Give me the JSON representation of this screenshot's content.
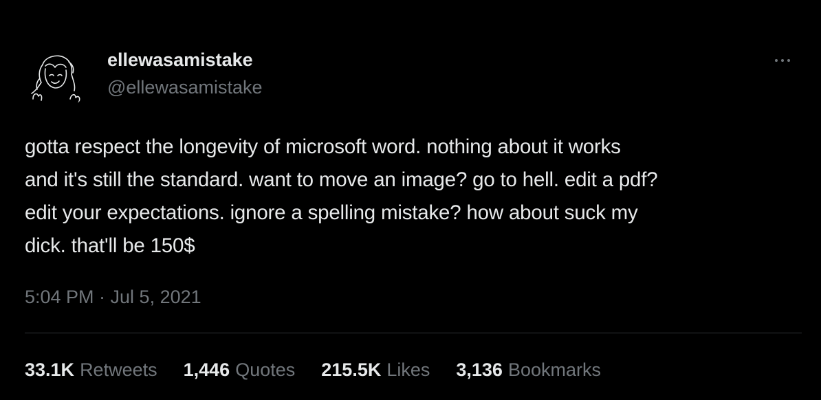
{
  "author": {
    "display_name": "ellewasamistake",
    "handle": "@ellewasamistake",
    "avatar_icon": "hand-drawn-girl-doodle-icon"
  },
  "tweet": {
    "text": "gotta respect the longevity of microsoft word. nothing about it works\nand it's still the standard. want to move an image? go to hell. edit a pdf?\nedit your expectations. ignore a spelling mistake? how about suck my\ndick. that'll be 150$",
    "timestamp": "5:04 PM · Jul 5, 2021"
  },
  "stats": [
    {
      "count": "33.1K",
      "label": "Retweets"
    },
    {
      "count": "1,446",
      "label": "Quotes"
    },
    {
      "count": "215.5K",
      "label": "Likes"
    },
    {
      "count": "3,136",
      "label": "Bookmarks"
    }
  ],
  "colors": {
    "background": "#000000",
    "primary_text": "#e7e9ea",
    "secondary_text": "#71767b",
    "divider": "#2f3336"
  }
}
